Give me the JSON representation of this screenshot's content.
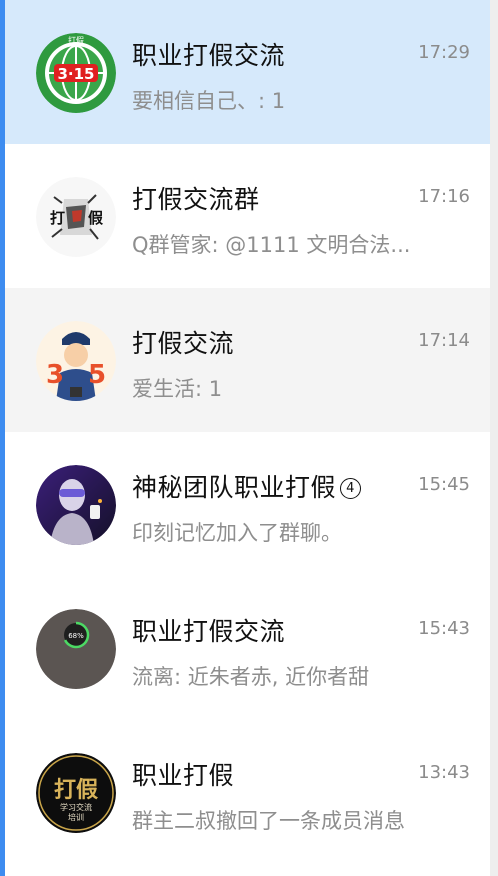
{
  "chats": [
    {
      "title": "职业打假交流",
      "time": "17:29",
      "preview": "要相信自己、: 1",
      "avatar": "315-green-logo",
      "state": "selected"
    },
    {
      "title": "打假交流群",
      "time": "17:16",
      "preview": "Q群管家: @1111 文明合法...",
      "avatar": "fist-da-jia-logo",
      "state": "normal"
    },
    {
      "title": "打假交流",
      "time": "17:14",
      "preview": "爱生活: 1",
      "avatar": "cartoon-officer-315",
      "state": "hover"
    },
    {
      "title": "神秘团队职业打假",
      "badge": "4",
      "time": "15:45",
      "preview": "印刻记忆加入了群聊。",
      "avatar": "masked-person-photo",
      "state": "normal"
    },
    {
      "title": "职业打假交流",
      "time": "15:43",
      "preview": "流离: 近朱者赤, 近你者甜",
      "avatar": "battery-68-widget",
      "state": "normal"
    },
    {
      "title": "职业打假",
      "time": "13:43",
      "preview": "群主二叔撤回了一条成员消息",
      "avatar": "da-jia-training-logo",
      "state": "normal"
    }
  ],
  "avatar_text": {
    "logo_315": "3·15",
    "logo_top": "打假",
    "fist_left": "打",
    "fist_right": "假",
    "battery_pct": "68%",
    "training_main": "打假",
    "training_sub1": "学习交流",
    "training_sub2": "培训"
  },
  "colors": {
    "selected_bg": "#d6e9fb",
    "hover_bg": "#f4f4f4",
    "accent_edge": "#3d8cf0"
  }
}
